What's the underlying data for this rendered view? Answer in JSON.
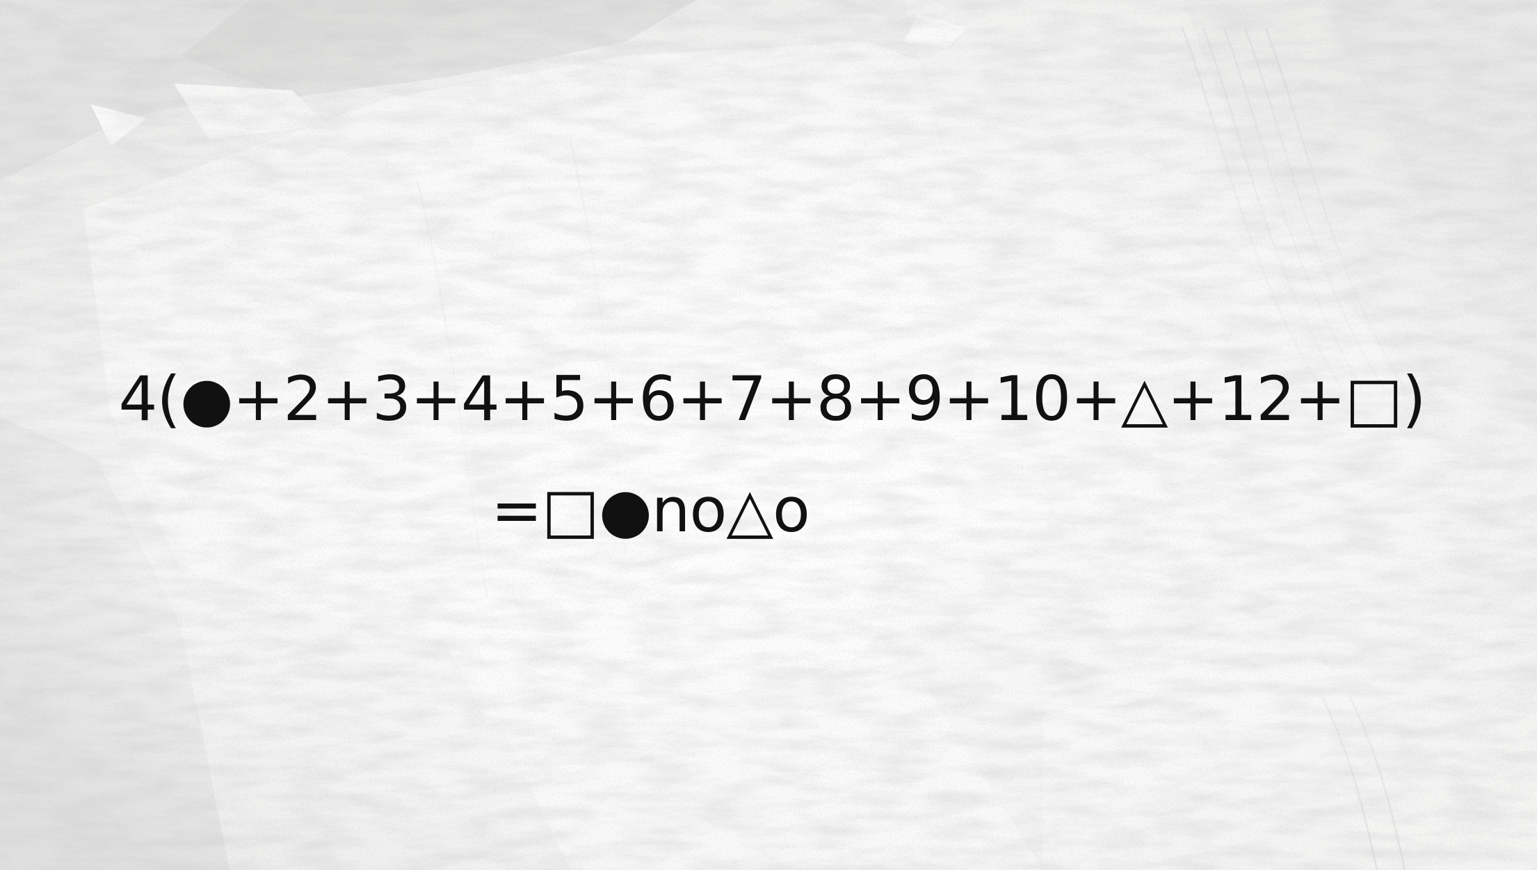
{
  "puzzle": {
    "equation": "4(●+2+3+4+5+6+7+8+9+10+△+12+□)",
    "result": "=□●no△o"
  }
}
